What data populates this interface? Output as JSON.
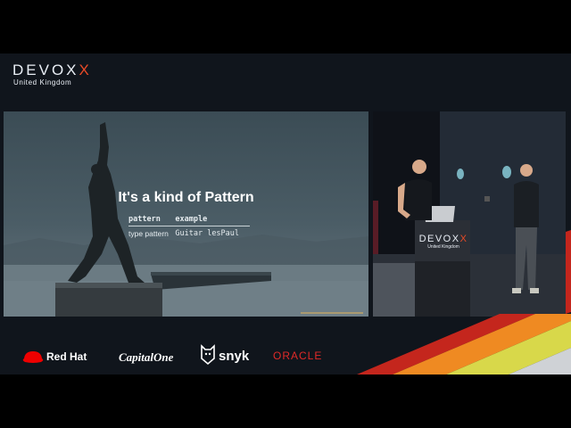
{
  "event": {
    "name": "DEVOX",
    "name_accent": "X",
    "region": "United Kingdom"
  },
  "slide": {
    "title": "It's a kind of Pattern",
    "table": {
      "headers": [
        "pattern",
        "example"
      ],
      "rows": [
        [
          "type pattern",
          "Guitar lesPaul"
        ]
      ]
    }
  },
  "lectern": {
    "name": "DEVOX",
    "name_accent": "X",
    "region": "United Kingdom"
  },
  "sponsors": {
    "redhat": "Red Hat",
    "capitalone": "CapitalOne",
    "snyk": "snyk",
    "oracle": "ORACLE"
  },
  "colors": {
    "accent_orange": "#e84a27",
    "stripe_red": "#c4261d",
    "stripe_orange": "#ef8a22",
    "stripe_yellow": "#d8d84a",
    "oracle_red": "#e02a28"
  }
}
